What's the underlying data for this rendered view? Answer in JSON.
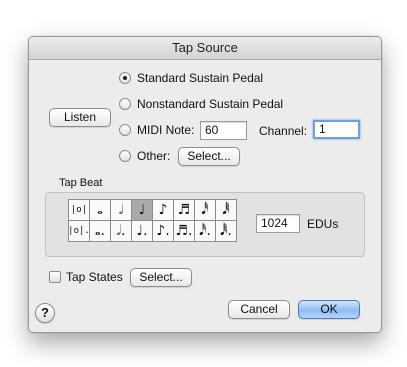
{
  "window": {
    "title": "Tap Source"
  },
  "source": {
    "listen_label": "Listen",
    "options": [
      {
        "label": "Standard Sustain Pedal",
        "selected": true
      },
      {
        "label": "Nonstandard Sustain Pedal",
        "selected": false
      },
      {
        "label": "MIDI Note:",
        "selected": false
      },
      {
        "label": "Other:",
        "selected": false
      }
    ],
    "midi_note_value": "60",
    "channel_label": "Channel:",
    "channel_value": "1",
    "other_select_label": "Select..."
  },
  "tap_beat": {
    "label": "Tap Beat",
    "selected_index": 3,
    "row1": [
      {
        "icon": "double-whole-note-icon",
        "glyph": "|o|"
      },
      {
        "icon": "whole-note-icon",
        "glyph": "𝅝"
      },
      {
        "icon": "half-note-icon",
        "glyph": "𝅗𝅥"
      },
      {
        "icon": "quarter-note-icon",
        "glyph": "♩"
      },
      {
        "icon": "eighth-note-icon",
        "glyph": "♪"
      },
      {
        "icon": "sixteenth-note-icon",
        "glyph": "♬"
      },
      {
        "icon": "thirty-second-note-icon",
        "glyph": "𝅘𝅥𝅰"
      },
      {
        "icon": "sixty-fourth-note-icon",
        "glyph": "𝅘𝅥𝅱"
      }
    ],
    "row2": [
      {
        "icon": "dotted-double-whole-note-icon",
        "glyph": "|o|."
      },
      {
        "icon": "dotted-whole-note-icon",
        "glyph": "𝅝."
      },
      {
        "icon": "dotted-half-note-icon",
        "glyph": "𝅗𝅥."
      },
      {
        "icon": "dotted-quarter-note-icon",
        "glyph": "♩."
      },
      {
        "icon": "dotted-eighth-note-icon",
        "glyph": "♪."
      },
      {
        "icon": "dotted-sixteenth-note-icon",
        "glyph": "♬."
      },
      {
        "icon": "dotted-thirty-second-note-icon",
        "glyph": "𝅘𝅥𝅰."
      },
      {
        "icon": "dotted-sixty-fourth-note-icon",
        "glyph": "𝅘𝅥𝅱."
      }
    ],
    "edu_value": "1024",
    "edu_label": "EDUs"
  },
  "tap_states": {
    "label": "Tap States",
    "checked": false,
    "select_label": "Select..."
  },
  "footer": {
    "help_glyph": "?",
    "cancel_label": "Cancel",
    "ok_label": "OK"
  }
}
